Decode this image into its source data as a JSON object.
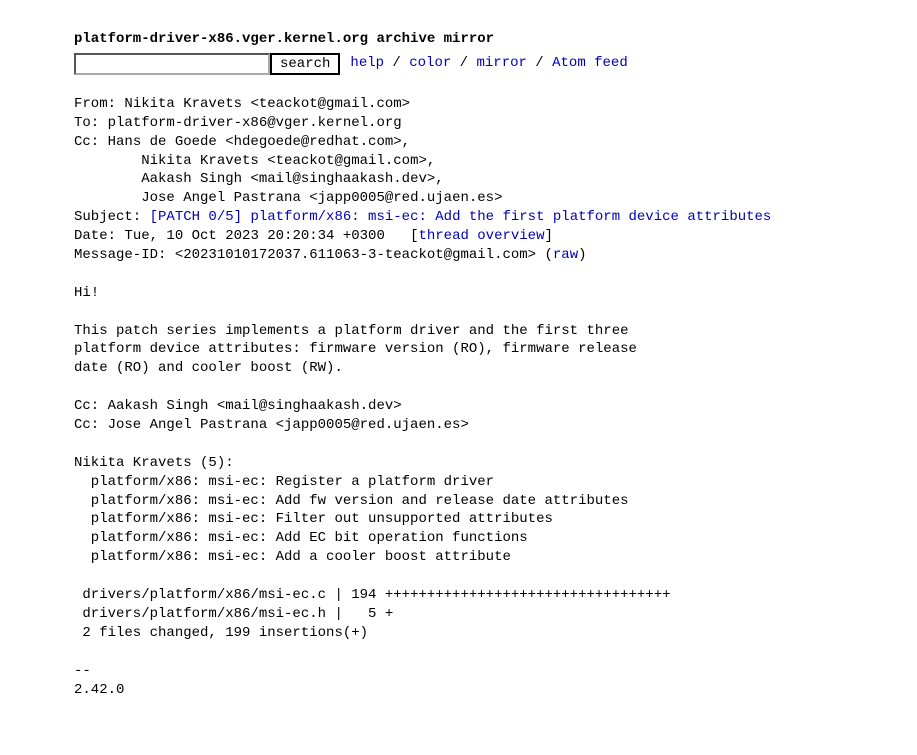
{
  "title": "platform-driver-x86.vger.kernel.org archive mirror",
  "search": {
    "button": "search"
  },
  "nav": {
    "help": "help",
    "color": "color",
    "mirror": "mirror",
    "atom": "Atom feed",
    "sep": " / "
  },
  "headers": {
    "from_label": "From: ",
    "from_value": "Nikita Kravets <teackot@gmail.com>",
    "to_label": "To: ",
    "to_value": "platform-driver-x86@vger.kernel.org",
    "cc_label": "Cc: ",
    "cc_value_line1": "Hans de Goede <hdegoede@redhat.com>,",
    "cc_line2": "\tNikita Kravets <teackot@gmail.com>,",
    "cc_line3": "\tAakash Singh <mail@singhaakash.dev>,",
    "cc_line4": "\tJose Angel Pastrana <japp0005@red.ujaen.es>",
    "subject_label": "Subject: ",
    "subject_link": "[PATCH 0/5] platform/x86: msi-ec: Add the first platform device attributes",
    "date_label": "Date: ",
    "date_value": "Tue, 10 Oct 2023 20:20:34 +0300",
    "date_gap": "\t",
    "thread_overview": "thread overview",
    "msgid_label": "Message-ID: ",
    "msgid_value": "<20231010172037.611063-3-teackot@gmail.com> ",
    "raw": "raw"
  },
  "body": "Hi!\n\nThis patch series implements a platform driver and the first three\nplatform device attributes: firmware version (RO), firmware release\ndate (RO) and cooler boost (RW).\n\nCc: Aakash Singh <mail@singhaakash.dev>\nCc: Jose Angel Pastrana <japp0005@red.ujaen.es>\n\nNikita Kravets (5):\n  platform/x86: msi-ec: Register a platform driver\n  platform/x86: msi-ec: Add fw version and release date attributes\n  platform/x86: msi-ec: Filter out unsupported attributes\n  platform/x86: msi-ec: Add EC bit operation functions\n  platform/x86: msi-ec: Add a cooler boost attribute\n\n drivers/platform/x86/msi-ec.c | 194 ++++++++++++++++++++++++++++++++++\n drivers/platform/x86/msi-ec.h |   5 +\n 2 files changed, 199 insertions(+)\n\n-- \n2.42.0\n"
}
